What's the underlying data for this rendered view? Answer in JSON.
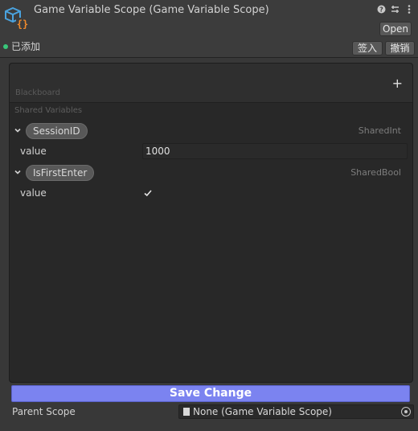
{
  "header": {
    "title": "Game Variable Scope (Game Variable Scope)",
    "open_label": "Open",
    "status_label": "已添加",
    "checkin_label": "签入",
    "revert_label": "撤销",
    "icons": [
      "help-icon",
      "preset-icon",
      "more-menu-icon"
    ]
  },
  "blackboard": {
    "title": "Blackboard",
    "add_icon": "+",
    "shared_label": "Shared Variables",
    "variables": [
      {
        "name": "SessionID",
        "type": "SharedInt",
        "prop_label": "value",
        "value": "1000"
      },
      {
        "name": "IsFirstEnter",
        "type": "SharedBool",
        "prop_label": "value",
        "checked": true
      }
    ]
  },
  "footer": {
    "save_label": "Save Change",
    "parent_label": "Parent Scope",
    "parent_value": "None (Game Variable Scope)"
  },
  "colors": {
    "accent": "#7b83f0",
    "status_dot": "#38c77a",
    "logo_blue": "#4aa3df",
    "logo_orange": "#f08a2c"
  }
}
